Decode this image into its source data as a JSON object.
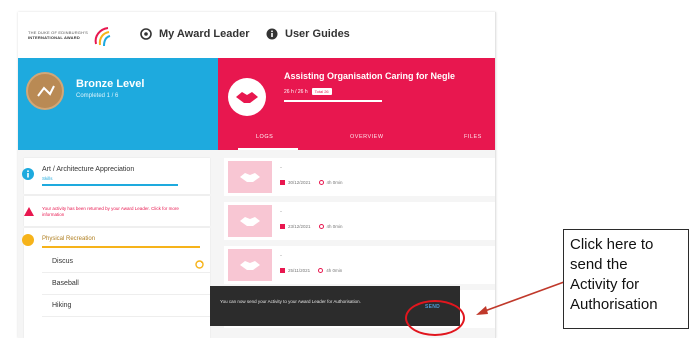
{
  "topbar": {
    "logo_line1": "THE DUKE OF EDINBURGH'S",
    "logo_line2": "INTERNATIONAL AWARD",
    "nav_award_leader": "My Award Leader",
    "nav_user_guides": "User Guides"
  },
  "level": {
    "title": "Bronze Level",
    "progress": "Completed 1 / 6"
  },
  "activity": {
    "title": "Assisting Organisation Caring for Negle",
    "hours": "26 h / 26 h",
    "tag": "Total 26",
    "tabs": [
      "LOGS",
      "OVERVIEW",
      "FILES"
    ]
  },
  "left": {
    "art_title": "Art / Architecture Appreciation",
    "art_sub": "Skills",
    "warning": "Your activity has been returned by your Award Leader. Click for more information",
    "phys_title": "Physical Recreation",
    "items": [
      "Discus",
      "Baseball",
      "Hiking"
    ]
  },
  "logs": [
    {
      "title": "-",
      "date": "30/12/2021",
      "duration": "4h 0min"
    },
    {
      "title": "-",
      "date": "23/12/2021",
      "duration": "4h 0min"
    },
    {
      "title": "-",
      "date": "25/11/2021",
      "duration": "4h 0min"
    }
  ],
  "toast": {
    "message": "You can now send your Activity to your Award Leader for Authorisation.",
    "send_label": "SEND"
  },
  "callout": {
    "text": "Click here to\nsend the\nActivity for\nAuthorisation"
  },
  "colors": {
    "pink": "#e8174f",
    "blue": "#1eaade",
    "gold": "#f6b31a",
    "annotation_red": "#e1161e"
  }
}
